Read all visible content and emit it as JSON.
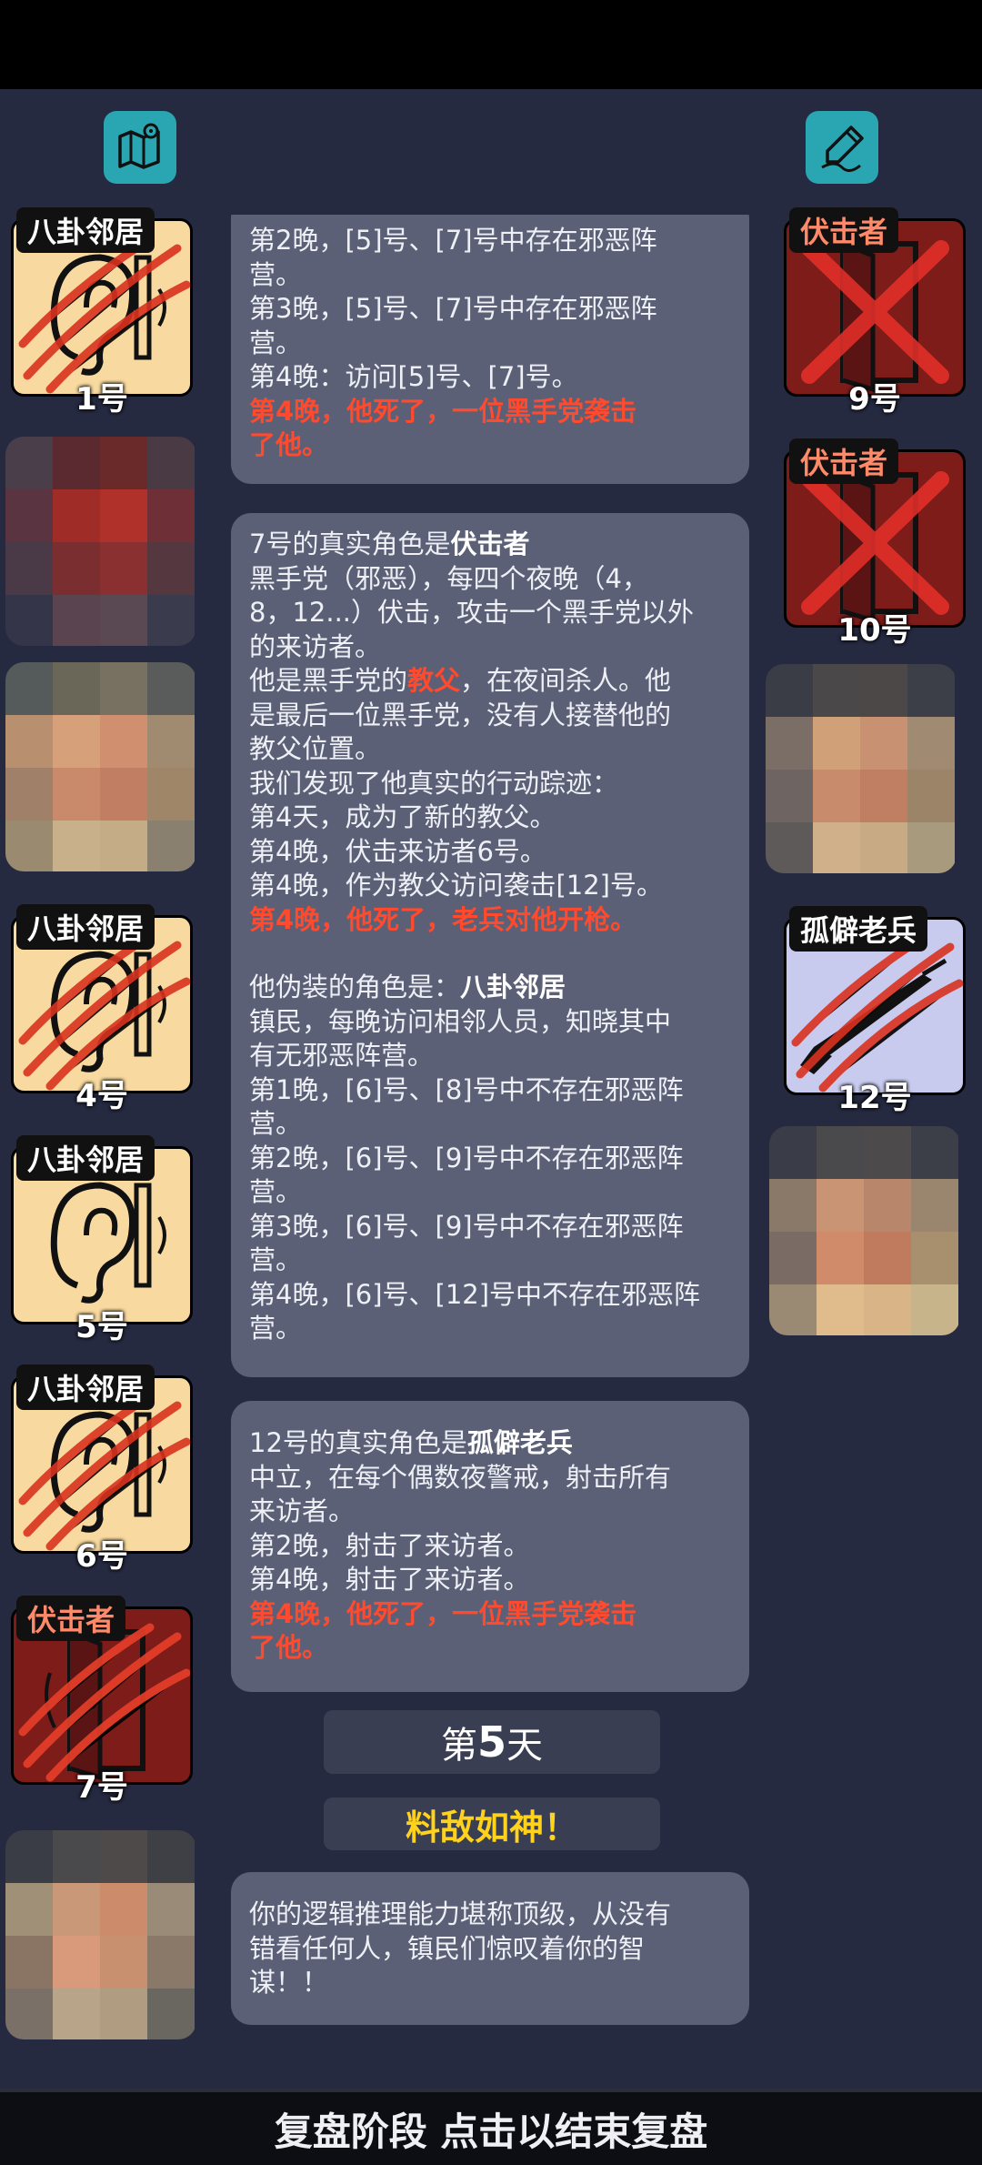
{
  "cards": [
    {
      "lines": [
        {
          "text": "第2晚，[5]号、[7]号中存在邪恶阵",
          "style": "normal"
        },
        {
          "text": "营。",
          "style": "normal"
        },
        {
          "text": "第3晚，[5]号、[7]号中存在邪恶阵",
          "style": "normal"
        },
        {
          "text": "营。",
          "style": "normal"
        },
        {
          "text": "第4晚：访问[5]号、[7]号。",
          "style": "normal"
        },
        {
          "text": "第4晚，他死了，一位黑手党袭击",
          "style": "red"
        },
        {
          "text": "了他。",
          "style": "red"
        }
      ]
    },
    {
      "title_prefix": "7号的真实角色是",
      "title_role": "伏击者",
      "lines": [
        {
          "text": "黑手党（邪恶），每四个夜晚（4，",
          "style": "normal"
        },
        {
          "text": "8，12...）伏击，攻击一个黑手党以外",
          "style": "normal"
        },
        {
          "text": "的来访者。",
          "style": "normal"
        }
      ],
      "godfather_line_a": "他是黑手党的",
      "godfather_word": "教父",
      "godfather_line_b": "，在夜间杀人。他",
      "lines2": [
        {
          "text": "是最后一位黑手党，没有人接替他的",
          "style": "normal"
        },
        {
          "text": "教父位置。",
          "style": "normal"
        },
        {
          "text": "我们发现了他真实的行动踪迹：",
          "style": "normal"
        },
        {
          "text": "第4天，成为了新的教父。",
          "style": "normal"
        },
        {
          "text": "第4晚，伏击来访者6号。",
          "style": "normal"
        },
        {
          "text": "第4晚，作为教父访问袭击[12]号。",
          "style": "normal"
        },
        {
          "text": "第4晚，他死了，老兵对他开枪。",
          "style": "red"
        }
      ],
      "disguise_prefix": "他伪装的角色是：",
      "disguise_role": "八卦邻居",
      "lines3": [
        {
          "text": "镇民，每晚访问相邻人员，知晓其中",
          "style": "normal"
        },
        {
          "text": "有无邪恶阵营。",
          "style": "normal"
        },
        {
          "text": "第1晚，[6]号、[8]号中不存在邪恶阵",
          "style": "normal"
        },
        {
          "text": "营。",
          "style": "normal"
        },
        {
          "text": "第2晚，[6]号、[9]号中不存在邪恶阵",
          "style": "normal"
        },
        {
          "text": "营。",
          "style": "normal"
        },
        {
          "text": "第3晚，[6]号、[9]号中不存在邪恶阵",
          "style": "normal"
        },
        {
          "text": "营。",
          "style": "normal"
        },
        {
          "text": "第4晚，[6]号、[12]号中不存在邪恶阵",
          "style": "normal"
        },
        {
          "text": "营。",
          "style": "normal"
        }
      ]
    },
    {
      "title_prefix": "12号的真实角色是",
      "title_role": "孤僻老兵",
      "lines": [
        {
          "text": "中立，在每个偶数夜警戒，射击所有",
          "style": "normal"
        },
        {
          "text": "来访者。",
          "style": "normal"
        },
        {
          "text": "第2晚，射击了来访者。",
          "style": "normal"
        },
        {
          "text": "第4晚，射击了来访者。",
          "style": "normal"
        },
        {
          "text": "第4晚，他死了，一位黑手党袭击",
          "style": "red"
        },
        {
          "text": "了他。",
          "style": "red"
        }
      ]
    },
    {
      "lines": [
        {
          "text": "你的逻辑推理能力堪称顶级，从没有",
          "style": "normal"
        },
        {
          "text": "错看任何人，镇民们惊叹着你的智",
          "style": "normal"
        },
        {
          "text": "谋！！",
          "style": "normal"
        }
      ]
    }
  ],
  "day": {
    "prefix": "第",
    "number": "5",
    "suffix": "天"
  },
  "banner": "料敌如神！",
  "bottom_bar": "复盘阶段 点击以结束复盘",
  "players_left": [
    {
      "role": "八卦邻居",
      "number": "1号",
      "card": "gossip-neighbor",
      "slashed": true
    },
    {
      "role": "八卦邻居",
      "number": "4号",
      "card": "gossip-neighbor",
      "slashed": true
    },
    {
      "role": "八卦邻居",
      "number": "5号",
      "card": "gossip-neighbor",
      "slashed": false
    },
    {
      "role": "八卦邻居",
      "number": "6号",
      "card": "gossip-neighbor",
      "slashed": true
    },
    {
      "role": "伏击者",
      "number": "7号",
      "card": "ambusher",
      "slashed": true
    }
  ],
  "players_right": [
    {
      "role": "伏击者",
      "number": "9号",
      "card": "ambusher",
      "crossed": true
    },
    {
      "role": "伏击者",
      "number": "10号",
      "card": "ambusher",
      "crossed": true
    },
    {
      "role": "孤僻老兵",
      "number": "12号",
      "card": "veteran",
      "slashed": true
    }
  ],
  "icons": {
    "top_left": "map-icon",
    "top_right": "notes-pen-icon"
  },
  "colors": {
    "accent": "#2aa5b2",
    "highlight_red": "#ff4a2d",
    "banner_yellow": "#ffd21c",
    "card_bg": "#5b6076"
  }
}
